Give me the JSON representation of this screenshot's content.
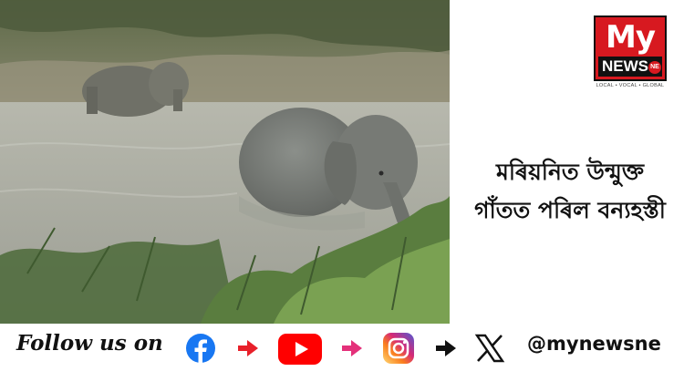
{
  "logo": {
    "brand_top": "My",
    "brand_bottom": "NEWS",
    "badge": "NE",
    "tagline": "LOCAL • VOCAL • GLOBAL",
    "colors": {
      "red": "#d71920",
      "black": "#111111"
    }
  },
  "headline": {
    "line1": "মৰিয়নিত উন্মুক্ত",
    "line2": "গাঁতত পৰিল বন্যহস্তী"
  },
  "follow": {
    "label": "Follow us on",
    "icons": [
      "facebook-icon",
      "youtube-icon",
      "instagram-icon",
      "x-icon"
    ],
    "arrows": [
      {
        "name": "arrow-icon",
        "color": "#e8202a"
      },
      {
        "name": "arrow-icon",
        "color": "#e4307a"
      },
      {
        "name": "arrow-icon",
        "color": "#111111"
      }
    ],
    "handle": "@mynewsne"
  },
  "photo": {
    "subject": "elephant-photo"
  }
}
